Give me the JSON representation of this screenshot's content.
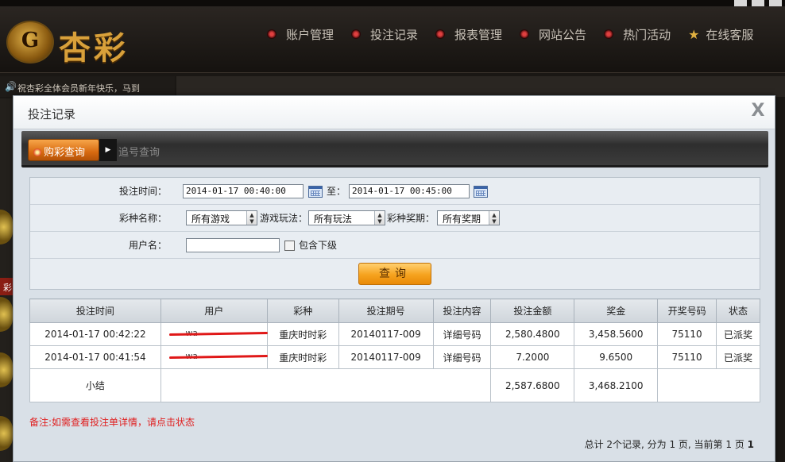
{
  "site": {
    "logo_text": "杏彩",
    "logo_mark": "G",
    "nav": [
      {
        "label": "账户管理"
      },
      {
        "label": "投注记录"
      },
      {
        "label": "报表管理"
      },
      {
        "label": "网站公告"
      },
      {
        "label": "热门活动"
      },
      {
        "label": "在线客服"
      }
    ],
    "notice": "祝杏彩全体会员新年快乐，马到",
    "side_label": "彩"
  },
  "modal": {
    "title": "投注记录",
    "close_label": "X",
    "tabs": {
      "active": "购彩查询",
      "inactive": "追号查询"
    },
    "form": {
      "bet_time_label": "投注时间：",
      "start_time": "2014-01-17 00:40:00",
      "to_label": "至：",
      "end_time": "2014-01-17 00:45:00",
      "lottery_name_label": "彩种名称：",
      "lottery_select": "所有游戏",
      "play_method_label": "游戏玩法：",
      "play_select": "所有玩法",
      "period_label": "彩种奖期：",
      "period_select": "所有奖期",
      "username_label": "用户名：",
      "username_value": "",
      "include_sub_label": "包含下级",
      "search_button": "查询"
    },
    "table": {
      "headers": [
        "投注时间",
        "用户",
        "彩种",
        "投注期号",
        "投注内容",
        "投注金额",
        "奖金",
        "开奖号码",
        "状态"
      ],
      "rows": [
        {
          "time": "2014-01-17 00:42:22",
          "user": "wa",
          "lottery": "重庆时时彩",
          "period": "20140117-009",
          "content": "详细号码",
          "amount": "2,580.4800",
          "prize": "3,458.5600",
          "draw": "75110",
          "status": "已派奖"
        },
        {
          "time": "2014-01-17 00:41:54",
          "user": "wa",
          "lottery": "重庆时时彩",
          "period": "20140117-009",
          "content": "详细号码",
          "amount": "7.2000",
          "prize": "9.6500",
          "draw": "75110",
          "status": "已派奖"
        }
      ],
      "subtotal": {
        "label": "小结",
        "amount": "2,587.6800",
        "prize": "3,468.2100"
      }
    },
    "note": "备注:如需查看投注单详情，请点击状态",
    "pager": {
      "prefix": "总计 2个记录, 分为 1 页, 当前第 1 页 ",
      "page": "1"
    }
  },
  "colors": {
    "accent_orange": "#f6a21e",
    "status_green": "#2a9a1a",
    "note_red": "#e02020"
  }
}
